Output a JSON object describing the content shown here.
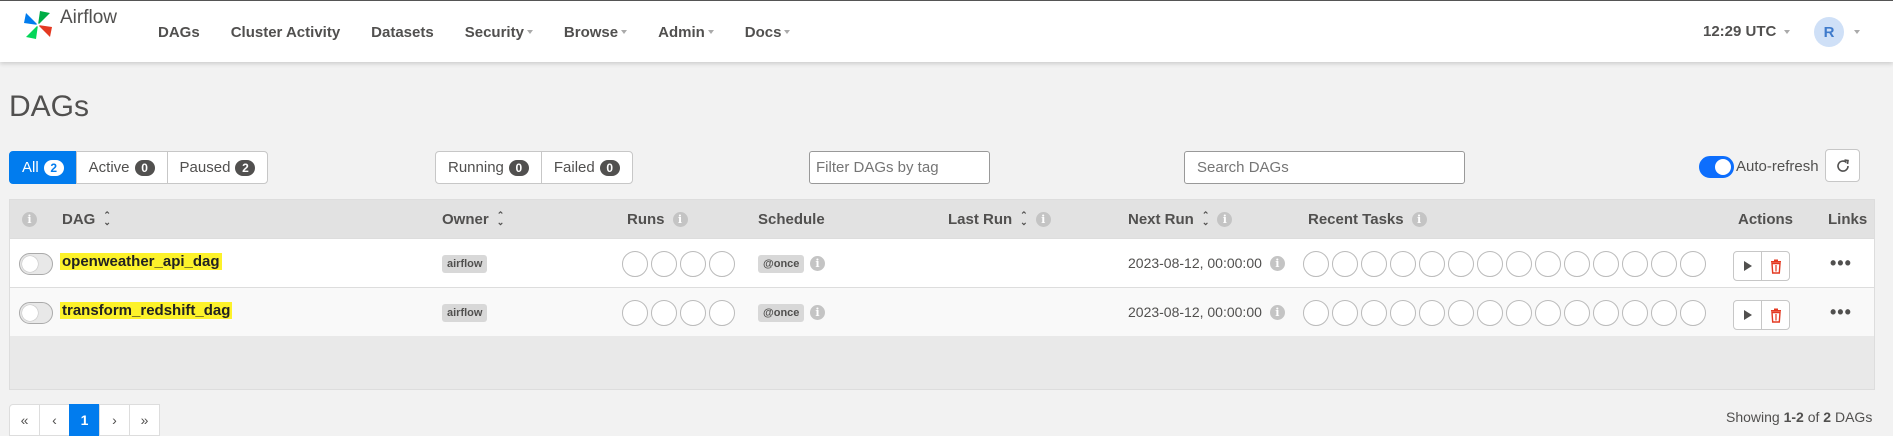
{
  "navbar": {
    "brand": "Airflow",
    "items": [
      {
        "label": "DAGs",
        "dropdown": false
      },
      {
        "label": "Cluster Activity",
        "dropdown": false
      },
      {
        "label": "Datasets",
        "dropdown": false
      },
      {
        "label": "Security",
        "dropdown": true
      },
      {
        "label": "Browse",
        "dropdown": true
      },
      {
        "label": "Admin",
        "dropdown": true
      },
      {
        "label": "Docs",
        "dropdown": true
      }
    ],
    "clock": "12:29 UTC",
    "user_initial": "R"
  },
  "page": {
    "title": "DAGs"
  },
  "filters": {
    "all_label": "All",
    "all_count": "2",
    "active_label": "Active",
    "active_count": "0",
    "paused_label": "Paused",
    "paused_count": "2",
    "running_label": "Running",
    "running_count": "0",
    "failed_label": "Failed",
    "failed_count": "0"
  },
  "tag_filter": {
    "placeholder": "Filter DAGs by tag"
  },
  "search": {
    "placeholder": "Search DAGs"
  },
  "auto_refresh": {
    "label": "Auto-refresh",
    "enabled": true
  },
  "table": {
    "headers": {
      "dag": "DAG",
      "owner": "Owner",
      "runs": "Runs",
      "schedule": "Schedule",
      "last_run": "Last Run",
      "next_run": "Next Run",
      "recent_tasks": "Recent Tasks",
      "actions": "Actions",
      "links": "Links"
    },
    "rows": [
      {
        "dag_id": "openweather_api_dag",
        "owner": "airflow",
        "schedule": "@once",
        "next_run": "2023-08-12, 00:00:00",
        "paused": true
      },
      {
        "dag_id": "transform_redshift_dag",
        "owner": "airflow",
        "schedule": "@once",
        "next_run": "2023-08-12, 00:00:00",
        "paused": true
      }
    ]
  },
  "pagination": {
    "first": "«",
    "prev": "‹",
    "current": "1",
    "next": "›",
    "last": "»"
  },
  "showing": {
    "prefix": "Showing",
    "range": "1-2",
    "of": "of",
    "total": "2",
    "suffix": "DAGs"
  },
  "colors": {
    "accent": "#017cee",
    "highlight": "#fdf22a"
  }
}
